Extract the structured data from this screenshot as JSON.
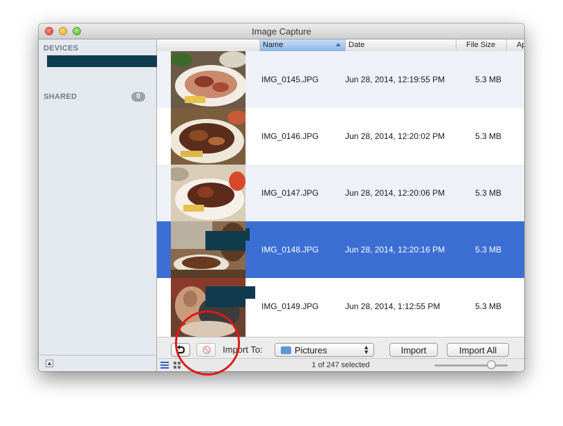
{
  "window": {
    "title": "Image Capture"
  },
  "sidebar": {
    "devices_heading": "DEVICES",
    "shared_heading": "SHARED",
    "shared_count": "0"
  },
  "columns": {
    "name": "Name",
    "date": "Date",
    "size": "File Size",
    "extra": "Ap"
  },
  "rows": [
    {
      "name": "IMG_0145.JPG",
      "date": "Jun 28, 2014, 12:19:55 PM",
      "size": "5.3 MB",
      "selected": false
    },
    {
      "name": "IMG_0146.JPG",
      "date": "Jun 28, 2014, 12:20:02 PM",
      "size": "5.3 MB",
      "selected": false
    },
    {
      "name": "IMG_0147.JPG",
      "date": "Jun 28, 2014, 12:20:06 PM",
      "size": "5.3 MB",
      "selected": false
    },
    {
      "name": "IMG_0148.JPG",
      "date": "Jun 28, 2014, 12:20:16 PM",
      "size": "5.3 MB",
      "selected": true
    },
    {
      "name": "IMG_0149.JPG",
      "date": "Jun 28, 2014, 1:12:55 PM",
      "size": "5.3 MB",
      "selected": false
    }
  ],
  "toolbar": {
    "import_to_label": "Import To:",
    "destination": "Pictures",
    "import_button": "Import",
    "import_all_button": "Import All"
  },
  "status": {
    "selection_text": "1 of 247 selected"
  },
  "colors": {
    "selection": "#3b6fd4",
    "redaction": "#0f3d4f",
    "annotation": "#e01818"
  }
}
